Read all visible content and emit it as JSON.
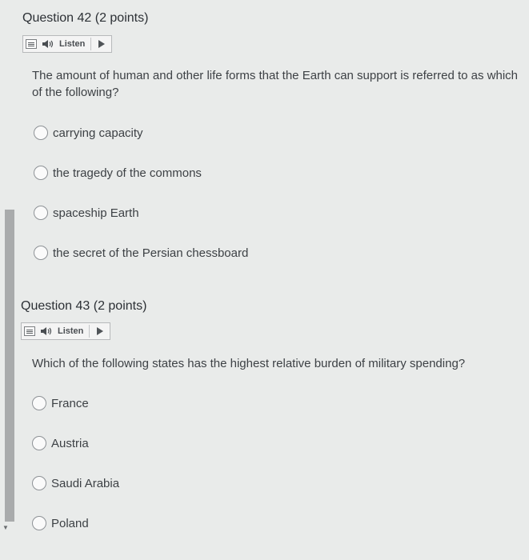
{
  "questions": [
    {
      "title": "Question 42",
      "points": "(2 points)",
      "listen_label": "Listen",
      "text": "The amount of human and other life forms that the Earth can support is referred to as which of the following?",
      "options": [
        "carrying capacity",
        "the tragedy of the commons",
        "spaceship Earth",
        "the secret of the Persian chessboard"
      ]
    },
    {
      "title": "Question 43",
      "points": "(2 points)",
      "listen_label": "Listen",
      "text": "Which of the following states has the highest relative burden of military spending?",
      "options": [
        "France",
        "Austria",
        "Saudi Arabia",
        "Poland"
      ]
    }
  ]
}
